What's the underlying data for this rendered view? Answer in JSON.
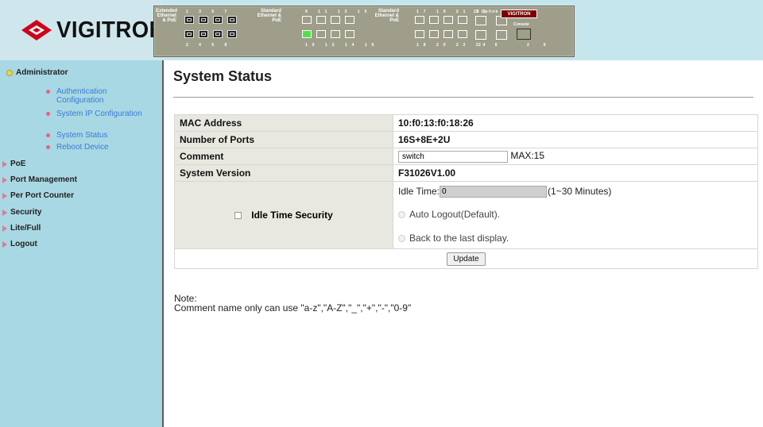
{
  "brand": {
    "name": "VIGITRON",
    "accent_red": "#d0021b"
  },
  "device_panel": {
    "group1_label": "Extended Ethernet & PoE",
    "group1_top_numbers": "1 3 5 7",
    "group1_bottom_numbers": "2 4 6 8",
    "group2_label": "Standard Ethernet & PoE",
    "group2_top_numbers": "9 11 13 15",
    "group2_bottom_numbers": "10 12 14 16",
    "group3_label": "Standard Ethernet & PoE",
    "group3_top_numbers": "17 19 21 23",
    "group3_bottom_numbers": "18 20 22 24",
    "uplink_label": "25 Uplink 25",
    "uplink_bottom": "26 26",
    "console_label": "Console",
    "badge": "VIGITRON"
  },
  "sidebar": {
    "section": "Administrator",
    "subitems": [
      "Authentication Configuration",
      "System IP Configuration",
      "System Status",
      "Reboot Device"
    ],
    "items": [
      "PoE",
      "Port Management",
      "Per Port Counter",
      "Security",
      "Lite/Full",
      "Logout"
    ]
  },
  "main": {
    "title": "System Status",
    "rows": [
      {
        "label": "MAC Address",
        "value": "10:f0:13:f0:18:26"
      },
      {
        "label": "Number of Ports",
        "value": "16S+8E+2U"
      },
      {
        "label": "Comment",
        "value": "switch",
        "suffix": "MAX:15"
      },
      {
        "label": "System Version",
        "value": "F31026V1.00"
      }
    ],
    "idle": {
      "label": "Idle Time Security",
      "time_label": "Idle Time:",
      "time_value": "0",
      "time_range": "(1~30 Minutes)",
      "option1": "Auto Logout(Default).",
      "option2": "Back to the last display."
    },
    "update_label": "Update",
    "note_title": "Note:",
    "note_text": "Comment name only can use \"a-z\",\"A-Z\",\"_\",\"+\",\"-\",\"0-9\""
  }
}
